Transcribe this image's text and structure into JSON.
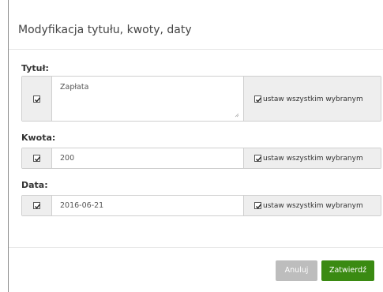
{
  "dialog": {
    "title": "Modyfikacja tytułu, kwoty, daty"
  },
  "fields": {
    "title": {
      "label": "Tytuł:",
      "value": "Zapłata",
      "checked": true,
      "apply_all_label": "ustaw wszystkim wybranym",
      "apply_all_checked": true
    },
    "amount": {
      "label": "Kwota:",
      "value": "200",
      "checked": true,
      "apply_all_label": "ustaw wszystkim wybranym",
      "apply_all_checked": true
    },
    "date": {
      "label": "Data:",
      "value": "2016-06-21",
      "checked": true,
      "apply_all_label": "ustaw wszystkim wybranym",
      "apply_all_checked": true
    }
  },
  "buttons": {
    "cancel_label": "Anuluj",
    "submit_label": "Zatwierdź"
  },
  "colors": {
    "submit": "#3a8a12",
    "cancel": "#bdbdbd",
    "addon_bg": "#eeeeee"
  }
}
